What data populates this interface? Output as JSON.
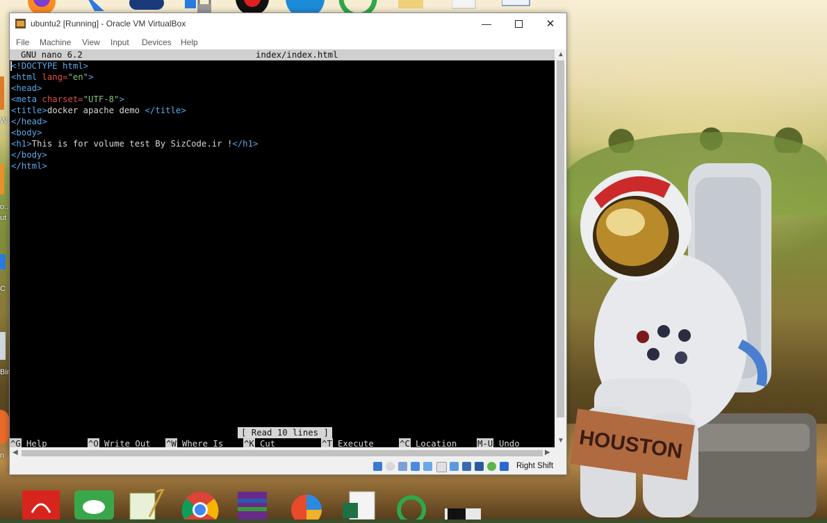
{
  "window": {
    "title": "ubuntu2 [Running] - Oracle VM VirtualBox",
    "controls": {
      "minimize": "—",
      "maximize": "☐",
      "close": "✕"
    }
  },
  "menu": [
    "File",
    "Machine",
    "View",
    "Input",
    "Devices",
    "Help"
  ],
  "nano": {
    "version": "GNU nano 6.2",
    "filename": "index/index.html",
    "status": "[ Read 10 lines ]",
    "shortcuts": [
      {
        "key": "^G",
        "label": "Help"
      },
      {
        "key": "^O",
        "label": "Write Out"
      },
      {
        "key": "^W",
        "label": "Where Is"
      },
      {
        "key": "^K",
        "label": "Cut"
      },
      {
        "key": "^T",
        "label": "Execute"
      },
      {
        "key": "^C",
        "label": "Location"
      },
      {
        "key": "M-U",
        "label": "Undo"
      }
    ]
  },
  "code": {
    "l1": {
      "open": "<!DOCTYPE html>"
    },
    "l2": {
      "open": "<html ",
      "attr": "lang=",
      "val": "\"en\"",
      "close": ">"
    },
    "l3": {
      "open": "<head>"
    },
    "l4": {
      "open": "<meta ",
      "attr": "charset=",
      "val": "\"UTF-8\"",
      "close": ">"
    },
    "l5": {
      "open": "<title>",
      "text": "docker apache demo ",
      "close": "</title>"
    },
    "l6": {
      "open": "</head>"
    },
    "l7": {
      "open": "<body>"
    },
    "l8": {
      "open": "<h1>",
      "text": "This is for volume test By SizCode.ir !",
      "close": "</h1>"
    },
    "l9": {
      "open": "</body>"
    },
    "l10": {
      "open": "</html>"
    }
  },
  "vm_status": {
    "host_key": "Right Shift"
  },
  "desktop": {
    "left_fragments": [
      "W",
      "o...",
      "ut",
      "C",
      "Bin",
      "n"
    ],
    "wallpaper_sign": "HOUSTON"
  },
  "colors": {
    "terminal_bg": "#000000",
    "tag": "#5aa9e6",
    "attribute": "#e0524a",
    "string": "#86c37a",
    "nano_bar": "#cfcfcf"
  }
}
